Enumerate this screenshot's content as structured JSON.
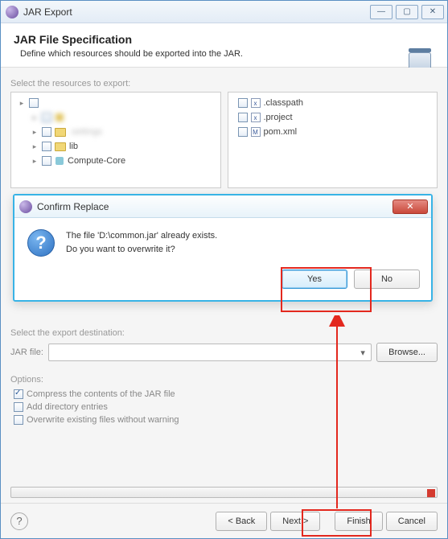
{
  "window": {
    "title": "JAR Export",
    "buttons": {
      "min": "—",
      "max": "▢",
      "close": "✕"
    }
  },
  "header": {
    "title": "JAR File Specification",
    "subtitle": "Define which resources should be exported into the JAR."
  },
  "resources": {
    "label": "Select the resources to export:",
    "left_tree": [
      {
        "depth": 0,
        "arrow": "▸",
        "label": "",
        "blur": true
      },
      {
        "depth": 1,
        "arrow": "▸",
        "label": "",
        "blur": true,
        "icon": "pkg-yellow"
      },
      {
        "depth": 1,
        "arrow": "▸",
        "label": ".settings",
        "blur": true,
        "icon": "folder"
      },
      {
        "depth": 1,
        "arrow": "▸",
        "label": "lib",
        "icon": "folder"
      },
      {
        "depth": 1,
        "arrow": "▸",
        "label": "Compute-Core",
        "icon": "pkg-cyan"
      }
    ],
    "right_files": [
      {
        "label": ".classpath"
      },
      {
        "label": ".project"
      },
      {
        "label": "pom.xml"
      }
    ]
  },
  "destination": {
    "label": "Select the export destination:",
    "jar_file_label": "JAR file:",
    "jar_file_value": "",
    "browse": "Browse..."
  },
  "options": {
    "label": "Options:",
    "compress": "Compress the contents of the JAR file",
    "add_dir": "Add directory entries",
    "overwrite": "Overwrite existing files without warning"
  },
  "footer": {
    "back": "< Back",
    "next": "Next >",
    "finish": "Finish",
    "cancel": "Cancel"
  },
  "dialog": {
    "title": "Confirm Replace",
    "message1": "The file 'D:\\common.jar' already exists.",
    "message2": "Do you want to overwrite it?",
    "yes": "Yes",
    "no": "No",
    "close_glyph": "✕"
  }
}
